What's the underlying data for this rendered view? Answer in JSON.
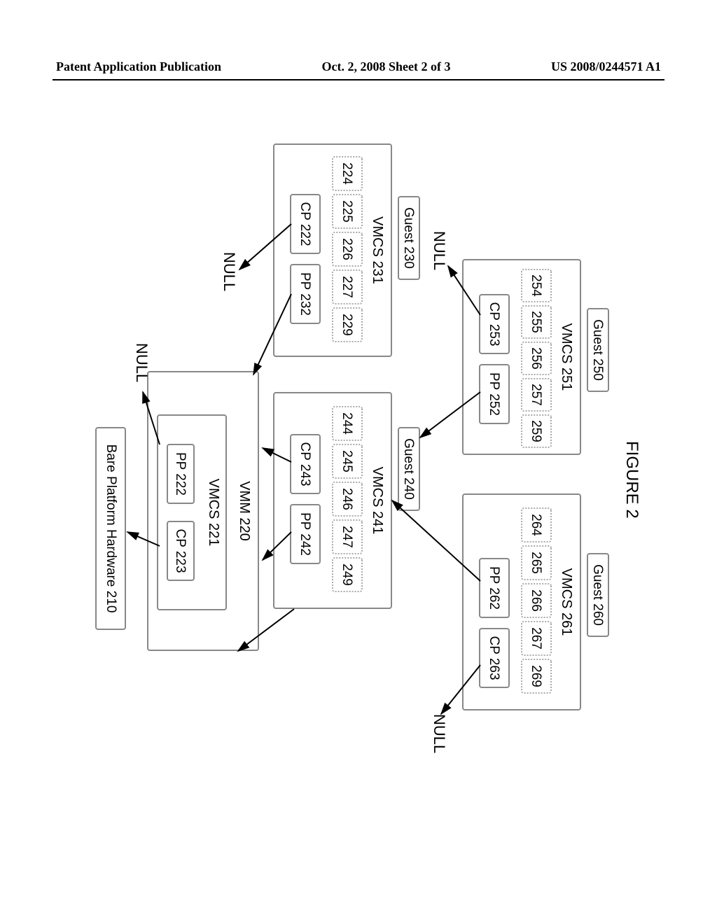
{
  "header": {
    "left": "Patent Application Publication",
    "center": "Oct. 2, 2008  Sheet 2 of 3",
    "right": "US 2008/0244571 A1"
  },
  "figure": {
    "title": "FIGURE 2",
    "guests": {
      "g250": "Guest 250",
      "g260": "Guest 260",
      "g230": "Guest 230",
      "g240": "Guest 240"
    },
    "vmcs": {
      "v251": "VMCS 251",
      "v261": "VMCS 261",
      "v231": "VMCS 231",
      "v241": "VMCS 241",
      "v221": "VMCS 221"
    },
    "regs": {
      "r254": "254",
      "r255": "255",
      "r256": "256",
      "r257": "257",
      "r259": "259",
      "r264": "264",
      "r265": "265",
      "r266": "266",
      "r267": "267",
      "r269": "269",
      "r224": "224",
      "r225": "225",
      "r226": "226",
      "r227": "227",
      "r229": "229",
      "r244": "244",
      "r245": "245",
      "r246": "246",
      "r247": "247",
      "r249": "249"
    },
    "cp_pp": {
      "cp253": "CP 253",
      "pp252": "PP 252",
      "pp262": "PP 262",
      "cp263": "CP 263",
      "cp222a": "CP 222",
      "pp232": "PP 232",
      "cp243": "CP 243",
      "pp242": "PP 242",
      "pp222": "PP 222",
      "cp223": "CP 223"
    },
    "vmm": "VMM 220",
    "hw": "Bare Platform Hardware 210",
    "null": "NULL"
  }
}
